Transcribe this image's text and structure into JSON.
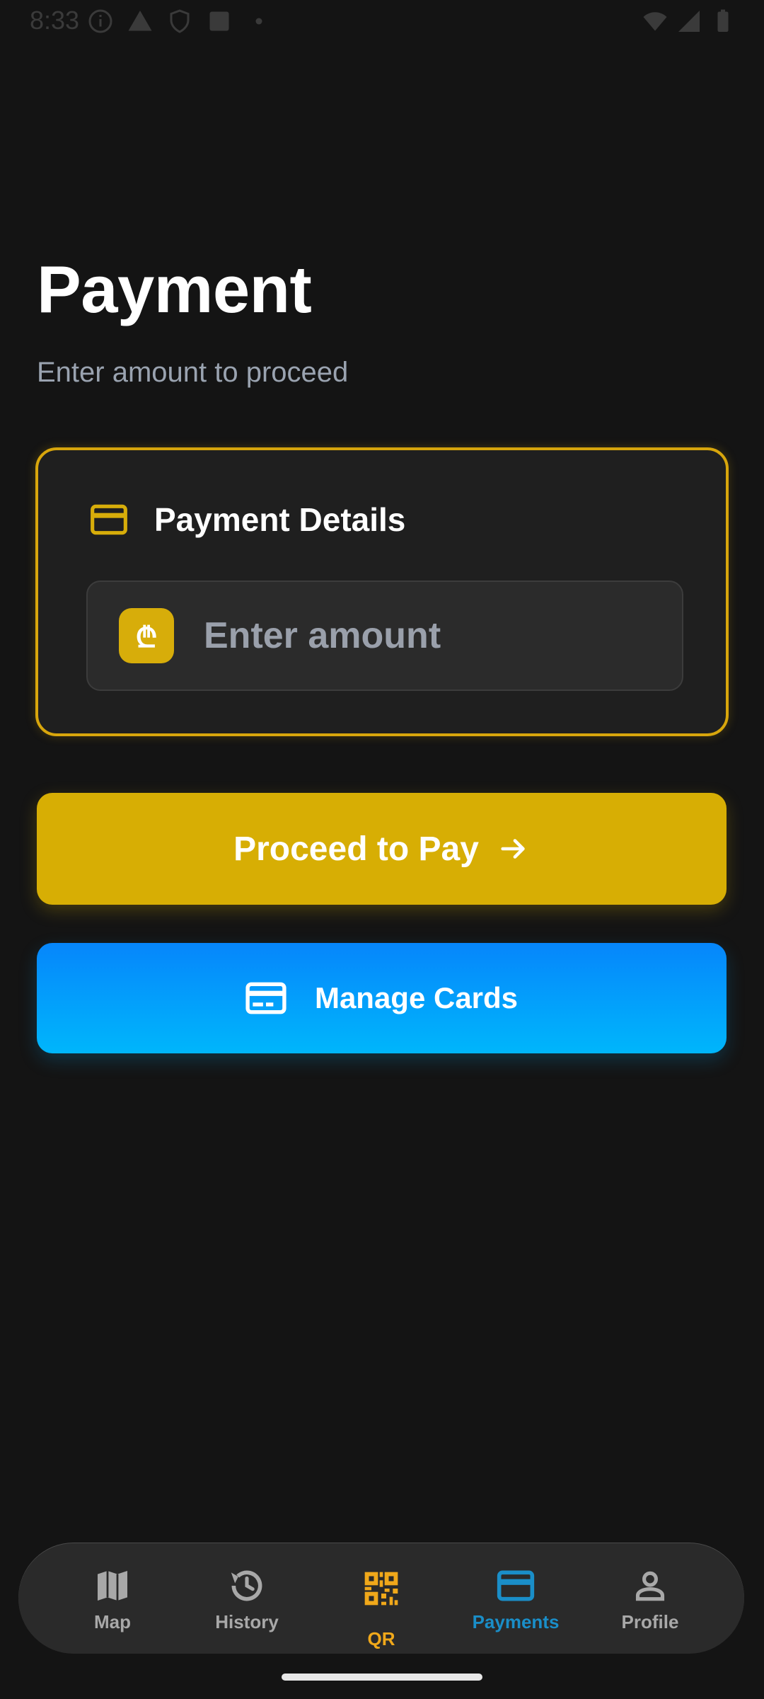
{
  "status_bar": {
    "time": "8:33"
  },
  "header": {
    "title": "Payment",
    "subtitle": "Enter amount to proceed"
  },
  "payment_card": {
    "title": "Payment Details",
    "currency_symbol": "₾",
    "amount_value": "",
    "amount_placeholder": "Enter amount"
  },
  "actions": {
    "proceed_label": "Proceed to Pay",
    "manage_cards_label": "Manage Cards"
  },
  "bottom_nav": {
    "active": "Payments",
    "items": [
      {
        "label": "Map",
        "icon": "map-icon"
      },
      {
        "label": "History",
        "icon": "history-icon"
      },
      {
        "label": "QR",
        "icon": "qr-code-icon"
      },
      {
        "label": "Payments",
        "icon": "card-icon"
      },
      {
        "label": "Profile",
        "icon": "person-icon"
      }
    ]
  },
  "colors": {
    "background": "#141414",
    "accent_gold": "#d7ae04",
    "accent_blue": "#0686fb",
    "active_nav": "#1a8ec8",
    "qr_orange": "#f0a81a"
  }
}
